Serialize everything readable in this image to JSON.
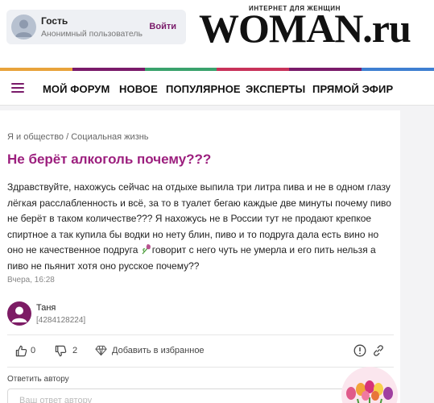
{
  "user": {
    "name": "Гость",
    "role": "Анонимный пользователь",
    "login_label": "Войти"
  },
  "logo": {
    "tagline": "ИНТЕРНЕТ ДЛЯ ЖЕНЩИН",
    "text": "WOMAN.ru"
  },
  "stripe_colors": [
    "#e8a33b",
    "#7a1b6a",
    "#3aa26c",
    "#c8325a",
    "#7a1b6a",
    "#3f7fd1"
  ],
  "nav": {
    "menu_icon": "hamburger-icon",
    "items": [
      "МОЙ ФОРУМ",
      "НОВОЕ",
      "ПОПУЛЯРНОЕ",
      "ЭКСПЕРТЫ",
      "ПРЯМОЙ ЭФИР"
    ]
  },
  "post": {
    "breadcrumb": "Я и общество / Социальная жизнь",
    "title": "Не берёт алкоголь почему???",
    "body_before": "Здравствуйте, нахожусь сейчас на отдыхе выпила три литра пива и не в одном глазу лёгкая расслабленность и всё, за то в туалет бегаю каждые две минуты почему пиво не берёт в таком количестве??? Я нахожусь не в России тут не продают крепкое спиртное а так купила бы водки но нету блин, пиво и то подруга дала есть вино но оно не качественное подруга ",
    "body_after": "говорит с него чуть не умерла и его пить нельзя а пиво не пьянит хотя оно русское почему??",
    "time": "Вчера, 16:28",
    "author": {
      "name": "Таня",
      "id": "[4284128224]"
    },
    "likes": "0",
    "dislikes": "2",
    "favorite_label": "Добавить в избранное"
  },
  "reply": {
    "label": "Ответить автору",
    "placeholder": "Ваш ответ автору"
  }
}
